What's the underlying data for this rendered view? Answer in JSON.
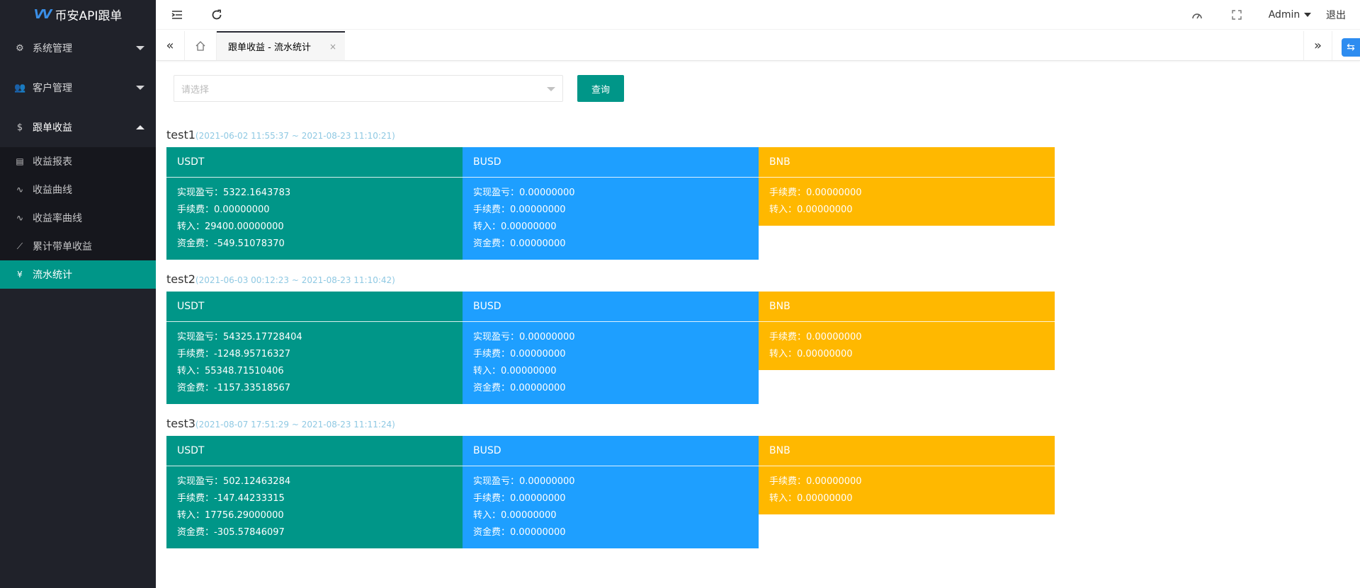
{
  "app": {
    "title": "币安API跟单"
  },
  "header": {
    "user": "Admin",
    "logout": "退出"
  },
  "sidebar": {
    "groups": [
      {
        "label": "系统管理",
        "icon": "gear-icon"
      },
      {
        "label": "客户管理",
        "icon": "users-icon"
      },
      {
        "label": "跟单收益",
        "icon": "money-circle-icon"
      }
    ],
    "items": [
      {
        "label": "收益报表",
        "icon": "clipboard-icon"
      },
      {
        "label": "收益曲线",
        "icon": "pulse-icon"
      },
      {
        "label": "收益率曲线",
        "icon": "pulse-icon"
      },
      {
        "label": "累计带单收益",
        "icon": "line-chart-icon"
      },
      {
        "label": "流水统计",
        "icon": "yen-icon"
      }
    ]
  },
  "tabs": [
    {
      "label": "跟单收益 - 流水统计",
      "close": "×"
    }
  ],
  "query": {
    "placeholder": "请选择",
    "button": "查询"
  },
  "colors": {
    "usdt": "#009688",
    "busd": "#1e9fff",
    "bnb": "#ffb800",
    "sidebar": "#20222a"
  },
  "accounts": [
    {
      "name": "test1",
      "range": "(2021-06-02 11:55:37 ~ 2021-08-23 11:10:21)",
      "usdt": {
        "title": "USDT",
        "lines": [
          "实现盈亏：5322.1643783",
          "手续费：0.00000000",
          "转入：29400.00000000",
          "资金费：-549.51078370"
        ]
      },
      "busd": {
        "title": "BUSD",
        "lines": [
          "实现盈亏：0.00000000",
          "手续费：0.00000000",
          "转入：0.00000000",
          "资金费：0.00000000"
        ]
      },
      "bnb": {
        "title": "BNB",
        "lines": [
          "手续费：0.00000000",
          "转入：0.00000000"
        ]
      }
    },
    {
      "name": "test2",
      "range": "(2021-06-03 00:12:23 ~ 2021-08-23 11:10:42)",
      "usdt": {
        "title": "USDT",
        "lines": [
          "实现盈亏：54325.17728404",
          "手续费：-1248.95716327",
          "转入：55348.71510406",
          "资金费：-1157.33518567"
        ]
      },
      "busd": {
        "title": "BUSD",
        "lines": [
          "实现盈亏：0.00000000",
          "手续费：0.00000000",
          "转入：0.00000000",
          "资金费：0.00000000"
        ]
      },
      "bnb": {
        "title": "BNB",
        "lines": [
          "手续费：0.00000000",
          "转入：0.00000000"
        ]
      }
    },
    {
      "name": "test3",
      "range": "(2021-08-07 17:51:29 ~ 2021-08-23 11:11:24)",
      "usdt": {
        "title": "USDT",
        "lines": [
          "实现盈亏：502.12463284",
          "手续费：-147.44233315",
          "转入：17756.29000000",
          "资金费：-305.57846097"
        ]
      },
      "busd": {
        "title": "BUSD",
        "lines": [
          "实现盈亏：0.00000000",
          "手续费：0.00000000",
          "转入：0.00000000",
          "资金费：0.00000000"
        ]
      },
      "bnb": {
        "title": "BNB",
        "lines": [
          "手续费：0.00000000",
          "转入：0.00000000"
        ]
      }
    }
  ]
}
